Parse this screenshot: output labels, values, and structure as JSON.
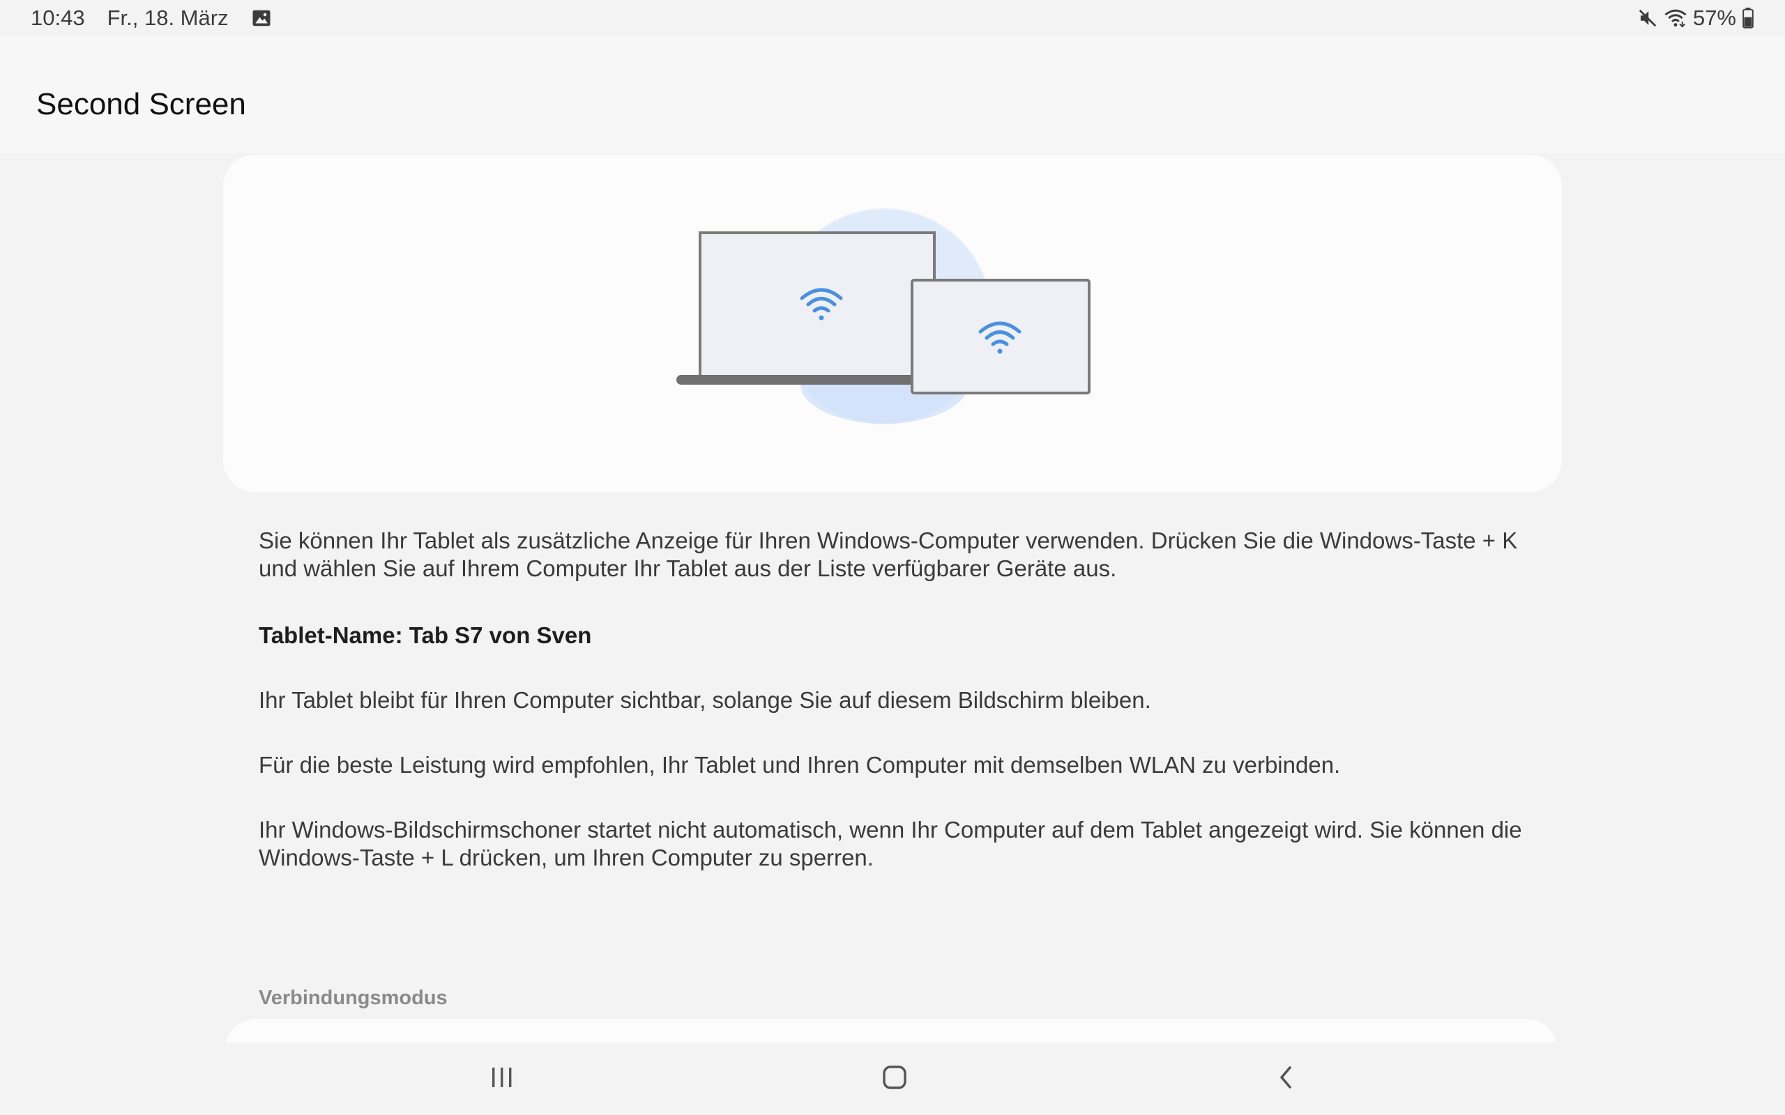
{
  "status_bar": {
    "time": "10:43",
    "date": "Fr., 18. März",
    "notification_icon": "image-icon",
    "icons": [
      "mute-icon",
      "wifi-icon",
      "battery-icon"
    ],
    "battery": "57%"
  },
  "app_bar": {
    "title": "Second Screen"
  },
  "illustration": {
    "description_icons": [
      "laptop-icon",
      "tablet-icon",
      "wifi-icon"
    ],
    "accent_color": "#4a90e2",
    "circle_color": "#d6e6fb"
  },
  "content": {
    "paragraphs": [
      "Sie können Ihr Tablet als zusätzliche Anzeige für Ihren Windows-Computer verwenden. Drücken Sie die Windows-Taste + K und wählen Sie auf Ihrem Computer Ihr Tablet aus der Liste verfügbarer Geräte aus.",
      "Tablet-Name: Tab S7 von Sven",
      "Ihr Tablet bleibt für Ihren Computer sichtbar, solange Sie auf diesem Bildschirm bleiben.",
      "Für die beste Leistung wird empfohlen, Ihr Tablet und Ihren Computer mit demselben WLAN zu verbinden.",
      "Ihr Windows-Bildschirmschoner startet nicht automatisch, wenn Ihr Computer auf dem Tablet angezeigt wird. Sie können die Windows-Taste + L drücken, um Ihren Computer zu sperren."
    ]
  },
  "section": {
    "label": "Verbindungsmodus"
  },
  "nav_bar": {
    "buttons": [
      "recent-apps-icon",
      "home-icon",
      "back-icon"
    ]
  }
}
